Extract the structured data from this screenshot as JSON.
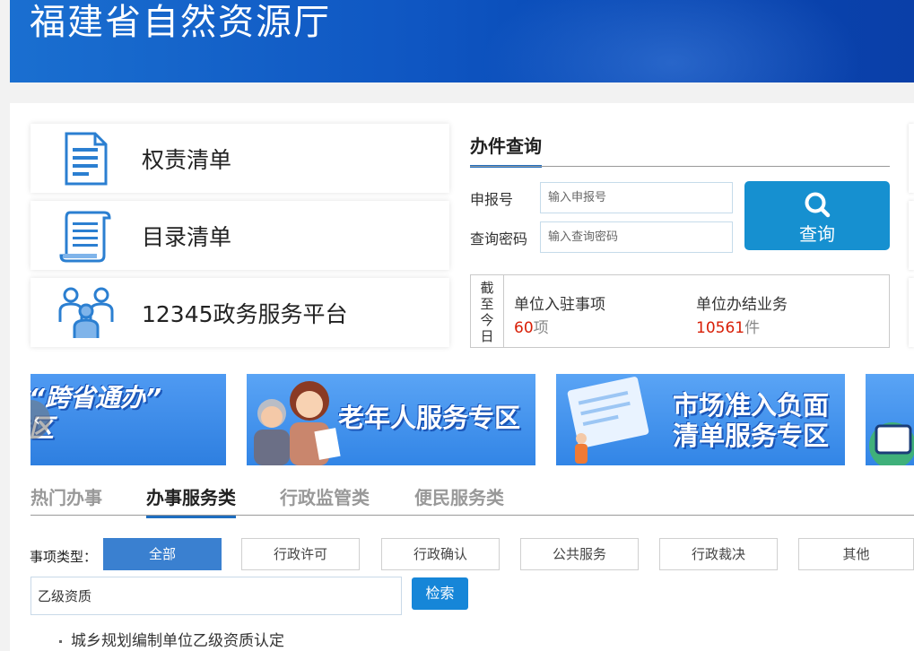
{
  "header": {
    "title": "福建省自然资源厅"
  },
  "quick_links": [
    {
      "label": "权责清单",
      "icon": "document-list-icon"
    },
    {
      "label": "目录清单",
      "icon": "scroll-list-icon"
    },
    {
      "label": "12345政务服务平台",
      "icon": "people-group-icon"
    }
  ],
  "query": {
    "title": "办件查询",
    "number_label": "申报号",
    "number_placeholder": "输入申报号",
    "password_label": "查询密码",
    "password_placeholder": "输入查询密码",
    "button_label": "查询"
  },
  "stats": {
    "date_chars": [
      "截",
      "至",
      "今",
      "日"
    ],
    "items": [
      {
        "label": "单位入驻事项",
        "value": "60",
        "unit": "项"
      },
      {
        "label": "单位办结业务",
        "value": "10561",
        "unit": "件"
      }
    ]
  },
  "banners": [
    {
      "line1": "福建省“跨省通办”",
      "line2": "服务专区"
    },
    {
      "line1": "老年人服务专区"
    },
    {
      "line1": "市场准入负面",
      "line2": "清单服务专区"
    }
  ],
  "banner_prev_icon": "chevron-left-icon",
  "tabs": [
    {
      "label": "热门办事",
      "active": false
    },
    {
      "label": "办事服务类",
      "active": true
    },
    {
      "label": "行政监管类",
      "active": false
    },
    {
      "label": "便民服务类",
      "active": false
    }
  ],
  "filter": {
    "label": "事项类型：",
    "options": [
      {
        "label": "全部",
        "active": true
      },
      {
        "label": "行政许可",
        "active": false
      },
      {
        "label": "行政确认",
        "active": false
      },
      {
        "label": "公共服务",
        "active": false
      },
      {
        "label": "行政裁决",
        "active": false
      },
      {
        "label": "其他",
        "active": false
      }
    ]
  },
  "search": {
    "value": "乙级资质",
    "button_label": "检索"
  },
  "results": [
    "城乡规划编制单位乙级资质认定"
  ],
  "colors": {
    "accent": "#1690d0",
    "highlight": "#d81e06",
    "header": "#0f56c2"
  }
}
